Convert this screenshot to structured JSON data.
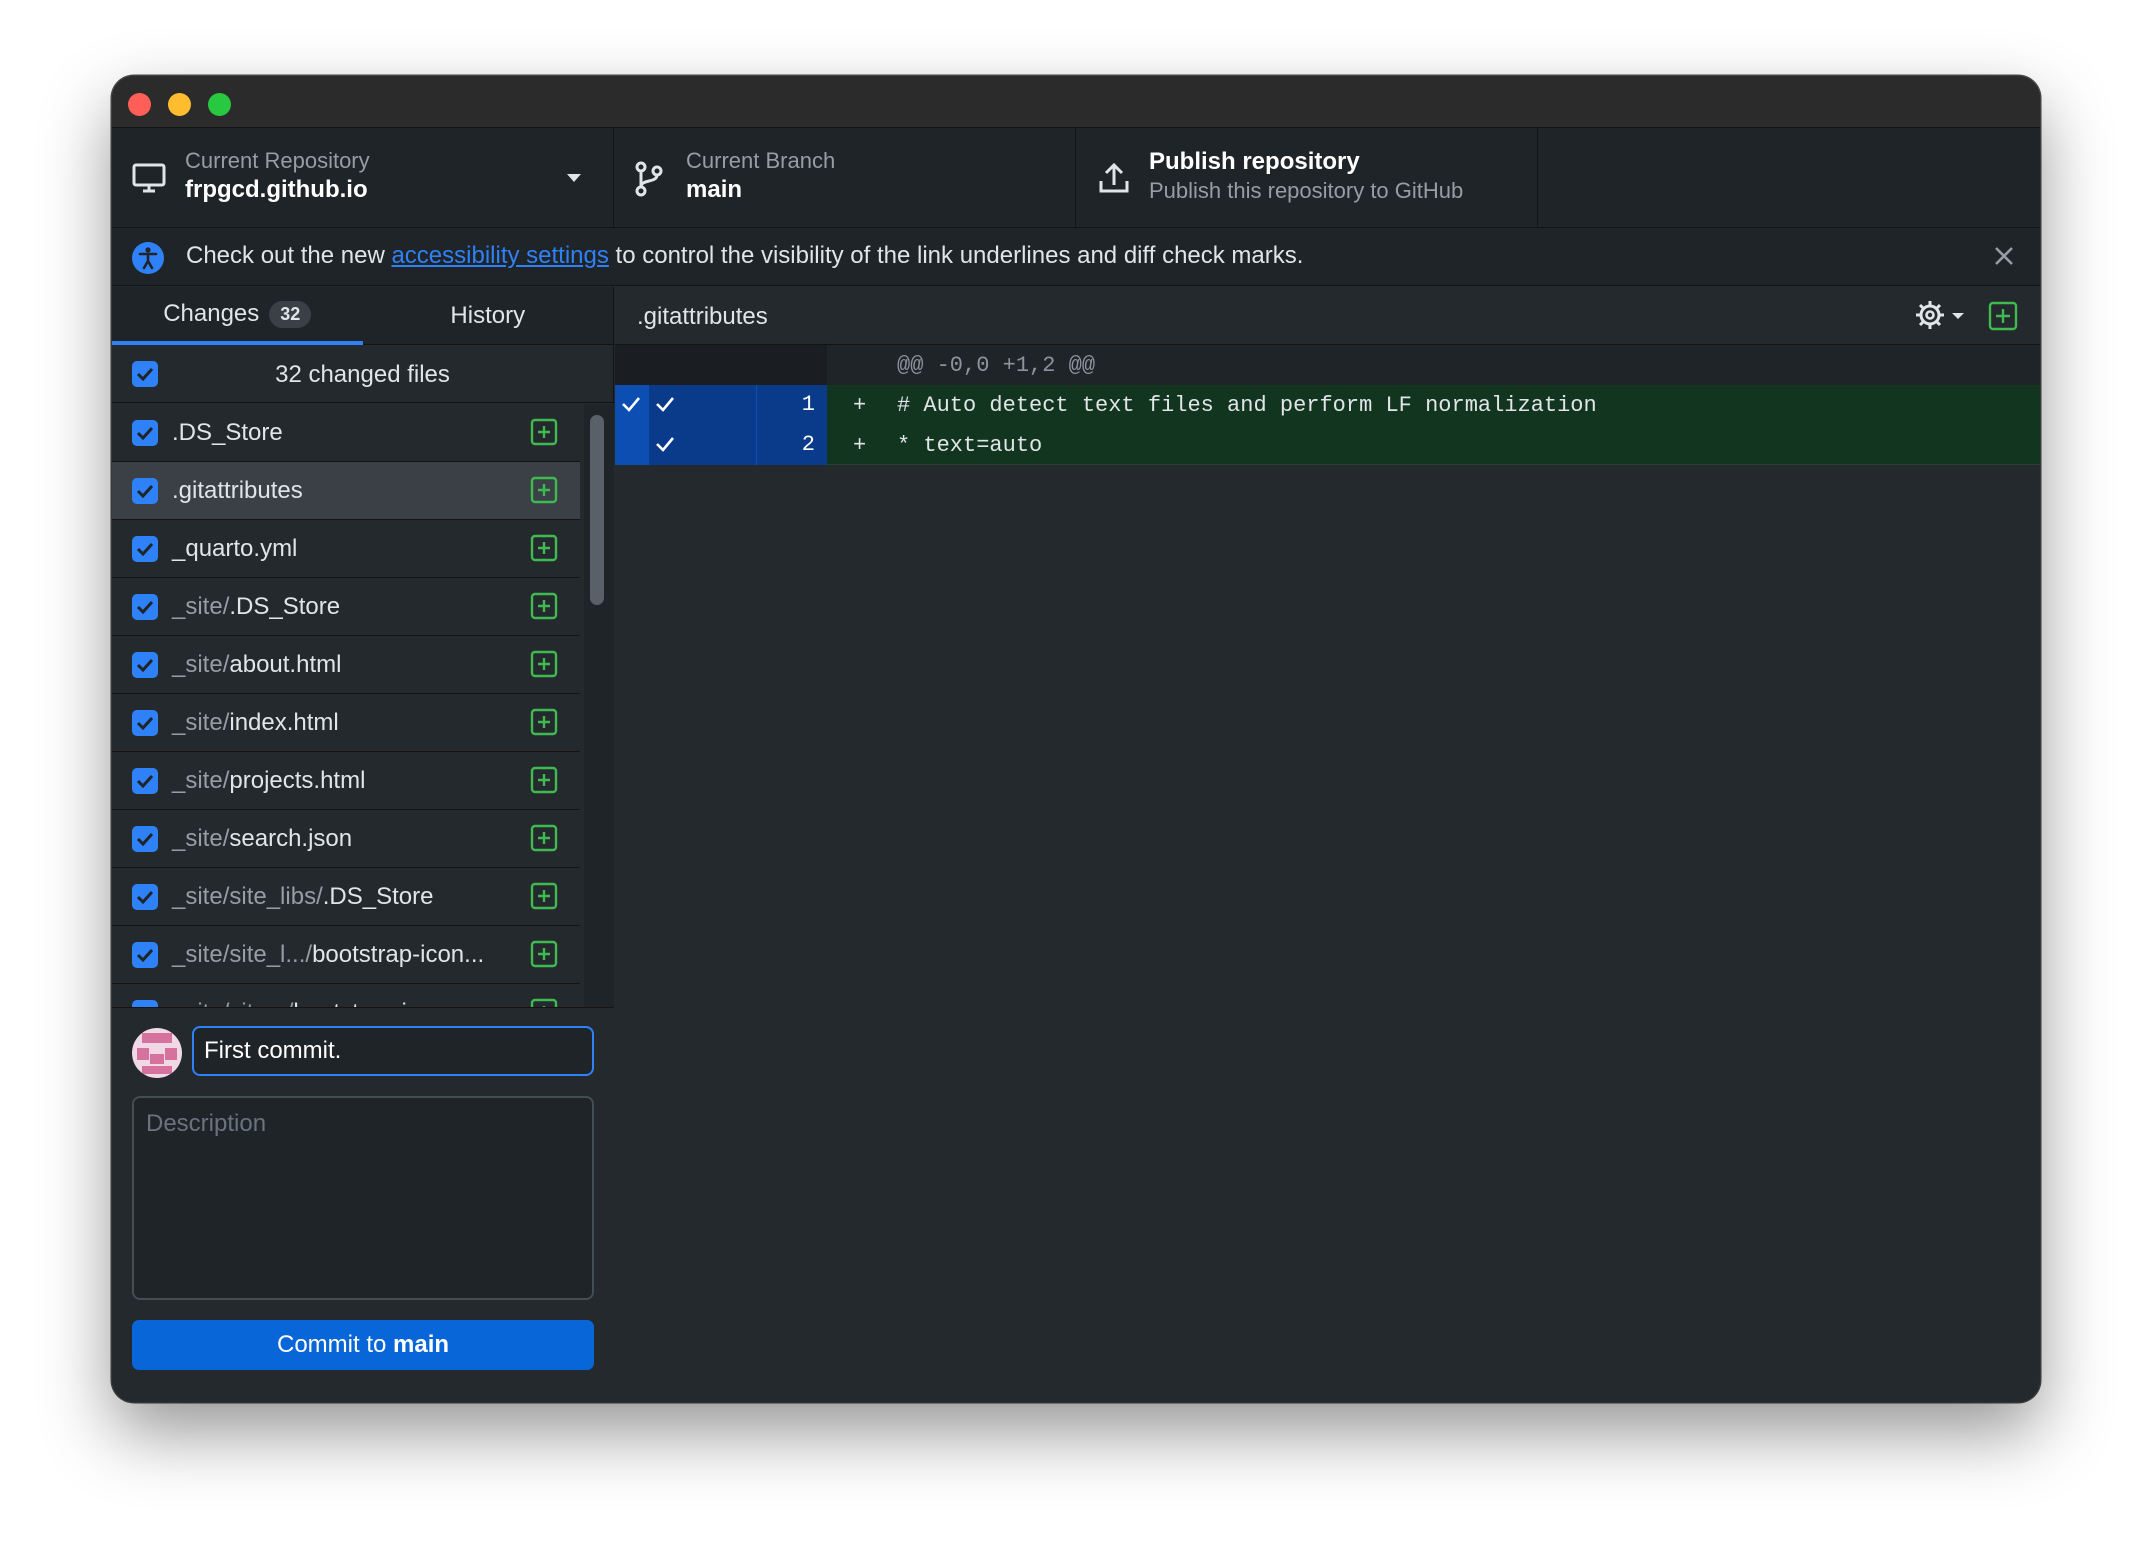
{
  "toolbar": {
    "repository": {
      "label": "Current Repository",
      "value": "frpgcd.github.io",
      "icon": "desktop-icon"
    },
    "branch": {
      "label": "Current Branch",
      "value": "main",
      "icon": "git-branch-icon"
    },
    "publish": {
      "title": "Publish repository",
      "subtitle": "Publish this repository to GitHub",
      "icon": "upload-icon"
    }
  },
  "banner": {
    "text_before": "Check out the new ",
    "link": "accessibility settings",
    "text_after": " to control the visibility of the link underlines and diff check marks."
  },
  "tabs": {
    "changes_label": "Changes",
    "changes_count": "32",
    "history_label": "History"
  },
  "changes_header": "32 changed files",
  "files": [
    {
      "dir": "",
      "name": ".DS_Store"
    },
    {
      "dir": "",
      "name": ".gitattributes"
    },
    {
      "dir": "",
      "name": "_quarto.yml"
    },
    {
      "dir": "_site/",
      "name": ".DS_Store"
    },
    {
      "dir": "_site/",
      "name": "about.html"
    },
    {
      "dir": "_site/",
      "name": "index.html"
    },
    {
      "dir": "_site/",
      "name": "projects.html"
    },
    {
      "dir": "_site/",
      "name": "search.json"
    },
    {
      "dir": "_site/site_libs/",
      "name": ".DS_Store"
    },
    {
      "dir": "_site/site_l.../",
      "name": "bootstrap-icon..."
    },
    {
      "dir": "_site/site.../",
      "name": "bootstrap-icons..."
    }
  ],
  "commit": {
    "summary_value": "First commit.",
    "description_placeholder": "Description",
    "button_prefix": "Commit to ",
    "button_branch": "main"
  },
  "diff": {
    "filename": ".gitattributes",
    "hunk_header": "@@ -0,0 +1,2 @@",
    "lines": [
      {
        "num": "1",
        "sign": "+",
        "code": "# Auto detect text files and perform LF normalization"
      },
      {
        "num": "2",
        "sign": "+",
        "code": "* text=auto"
      }
    ]
  },
  "colors": {
    "accent": "#2f81f7",
    "added": "#3fb950",
    "commit_button": "#0866d8"
  }
}
